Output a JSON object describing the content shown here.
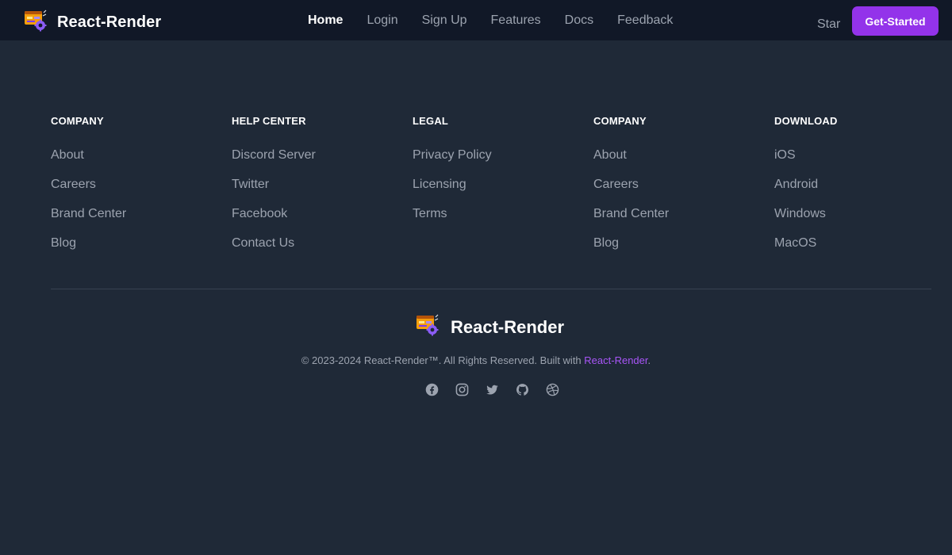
{
  "navbar": {
    "brand_name": "React-Render",
    "links": [
      {
        "label": "Home",
        "active": true
      },
      {
        "label": "Login"
      },
      {
        "label": "Sign Up"
      },
      {
        "label": "Features"
      },
      {
        "label": "Docs"
      },
      {
        "label": "Feedback"
      }
    ],
    "star_label": "Star",
    "cta_label": "Get-Started"
  },
  "footer": {
    "columns": [
      {
        "heading": "COMPANY",
        "items": [
          "About",
          "Careers",
          "Brand Center",
          "Blog"
        ]
      },
      {
        "heading": "HELP CENTER",
        "items": [
          "Discord Server",
          "Twitter",
          "Facebook",
          "Contact Us"
        ]
      },
      {
        "heading": "LEGAL",
        "items": [
          "Privacy Policy",
          "Licensing",
          "Terms"
        ]
      },
      {
        "heading": "COMPANY",
        "items": [
          "About",
          "Careers",
          "Brand Center",
          "Blog"
        ]
      },
      {
        "heading": "DOWNLOAD",
        "items": [
          "iOS",
          "Android",
          "Windows",
          "MacOS"
        ]
      }
    ],
    "brand_name": "React-Render",
    "copyright_prefix": "© 2023-2024 React-Render™. All Rights Reserved. Built with ",
    "copyright_link": "React-Render",
    "copyright_suffix": ".",
    "social_icons": [
      "facebook-icon",
      "instagram-icon",
      "twitter-icon",
      "github-icon",
      "dribbble-icon"
    ]
  },
  "colors": {
    "background": "#1f2937",
    "navbar": "#111827",
    "accent": "#9333ea",
    "link_accent": "#a855f7",
    "muted_text": "#9ca3af"
  }
}
